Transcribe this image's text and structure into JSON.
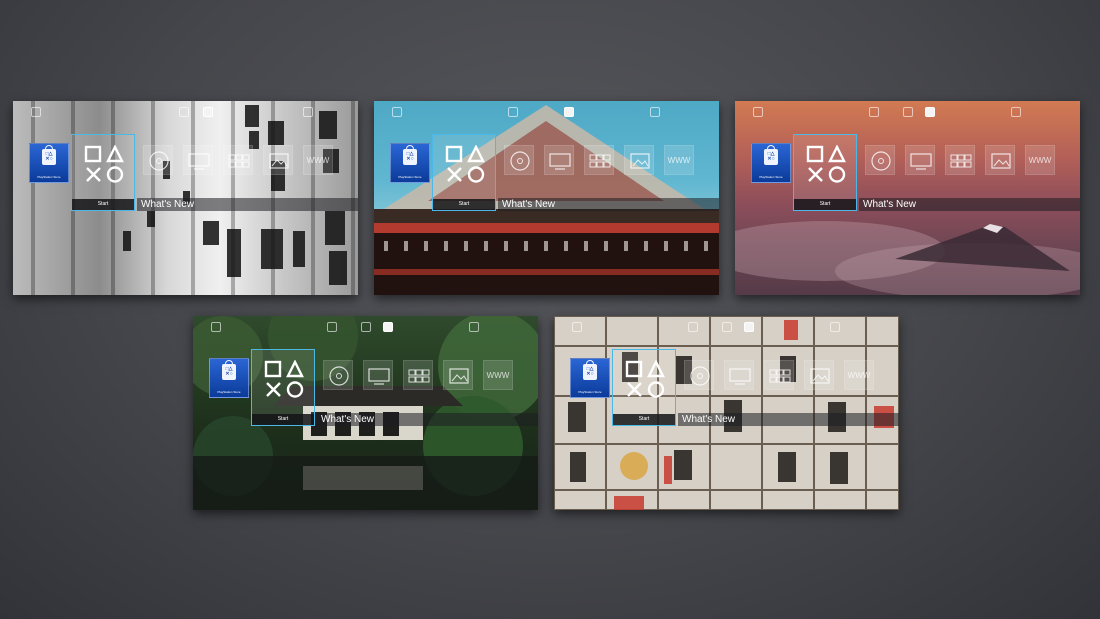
{
  "screens": [
    {
      "theme": "calligraphy",
      "store_label": "PlayStation Store",
      "start_label": "Start",
      "whats_new": "What's New",
      "www": "WWW"
    },
    {
      "theme": "temple-sky",
      "store_label": "PlayStation Store",
      "start_label": "Start",
      "whats_new": "What's New",
      "www": "WWW"
    },
    {
      "theme": "sunset-mount-fuji",
      "store_label": "PlayStation Store",
      "start_label": "Start",
      "whats_new": "What's New",
      "www": "WWW"
    },
    {
      "theme": "forest-pavilion",
      "store_label": "PlayStation Store",
      "start_label": "Start",
      "whats_new": "What's New",
      "www": "WWW"
    },
    {
      "theme": "sake-barrels",
      "store_label": "PlayStation Store",
      "start_label": "Start",
      "whats_new": "What's New",
      "www": "WWW"
    }
  ],
  "icons": [
    "playstation-store-icon",
    "ps-shapes-icon",
    "disc-icon",
    "tv-icon",
    "grid-icon",
    "gallery-icon",
    "www-icon"
  ],
  "colors": {
    "selection_border": "#4cb8e8",
    "store_blue": "#1c4fb8"
  }
}
